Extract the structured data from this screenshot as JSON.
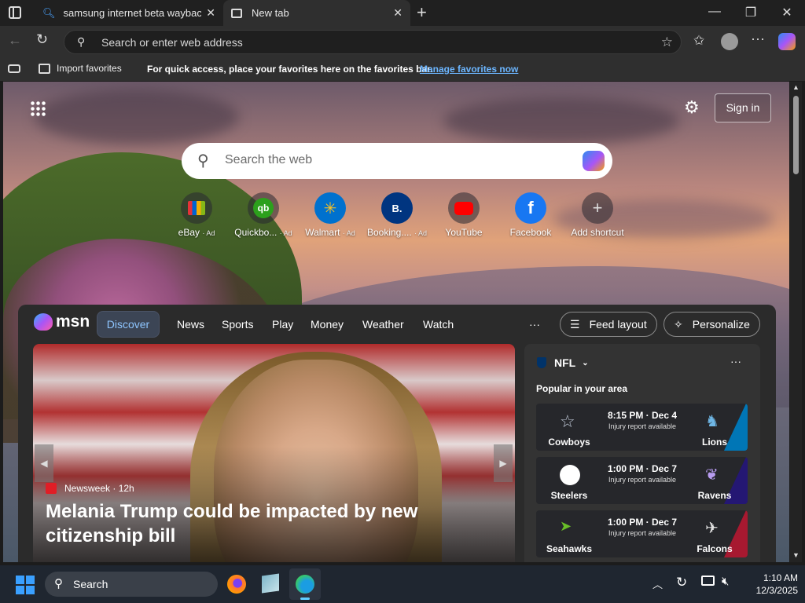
{
  "tabs": [
    {
      "title": "samsung internet beta wayback m",
      "active": false
    },
    {
      "title": "New tab",
      "active": true
    }
  ],
  "address_bar": {
    "placeholder": "Search or enter web address"
  },
  "favorites_bar": {
    "import_label": "Import favorites",
    "message": "For quick access, place your favorites here on the favorites bar.",
    "link": "Manage favorites now"
  },
  "newtab": {
    "sign_in": "Sign in",
    "search_placeholder": "Search the web",
    "shortcuts": [
      {
        "label": "eBay",
        "ad": "· Ad",
        "icon": "ebay-icon"
      },
      {
        "label": "Quickbo...",
        "ad": "· Ad",
        "icon": "quickbooks-icon"
      },
      {
        "label": "Walmart",
        "ad": "· Ad",
        "icon": "walmart-icon"
      },
      {
        "label": "Booking....",
        "ad": "· Ad",
        "icon": "booking-icon"
      },
      {
        "label": "YouTube",
        "ad": "",
        "icon": "youtube-icon"
      },
      {
        "label": "Facebook",
        "ad": "",
        "icon": "facebook-icon"
      },
      {
        "label": "Add shortcut",
        "ad": "",
        "icon": "plus-icon"
      }
    ]
  },
  "msn": {
    "logo": "msn",
    "nav": [
      "Discover",
      "News",
      "Sports",
      "Play",
      "Money",
      "Weather",
      "Watch"
    ],
    "more": "···",
    "feed_layout": "Feed layout",
    "personalize": "Personalize",
    "hero": {
      "source": "Newsweek",
      "age": "· 12h",
      "headline": "Melania Trump could be impacted by new citizenship bill"
    },
    "nfl": {
      "title": "NFL",
      "subtitle": "Popular in your area",
      "more": "···",
      "games": [
        {
          "time": "8:15 PM · Dec 4",
          "note": "Injury report available",
          "home": "Cowboys",
          "away": "Lions",
          "right_color": "#0076b6"
        },
        {
          "time": "1:00 PM · Dec 7",
          "note": "Injury report available",
          "home": "Steelers",
          "away": "Ravens",
          "right_color": "#241773"
        },
        {
          "time": "1:00 PM · Dec 7",
          "note": "Injury report available",
          "home": "Seahawks",
          "away": "Falcons",
          "right_color": "#a71930"
        }
      ]
    }
  },
  "taskbar": {
    "search_label": "Search",
    "time": "1:10 AM",
    "date": "12/3/2025"
  }
}
